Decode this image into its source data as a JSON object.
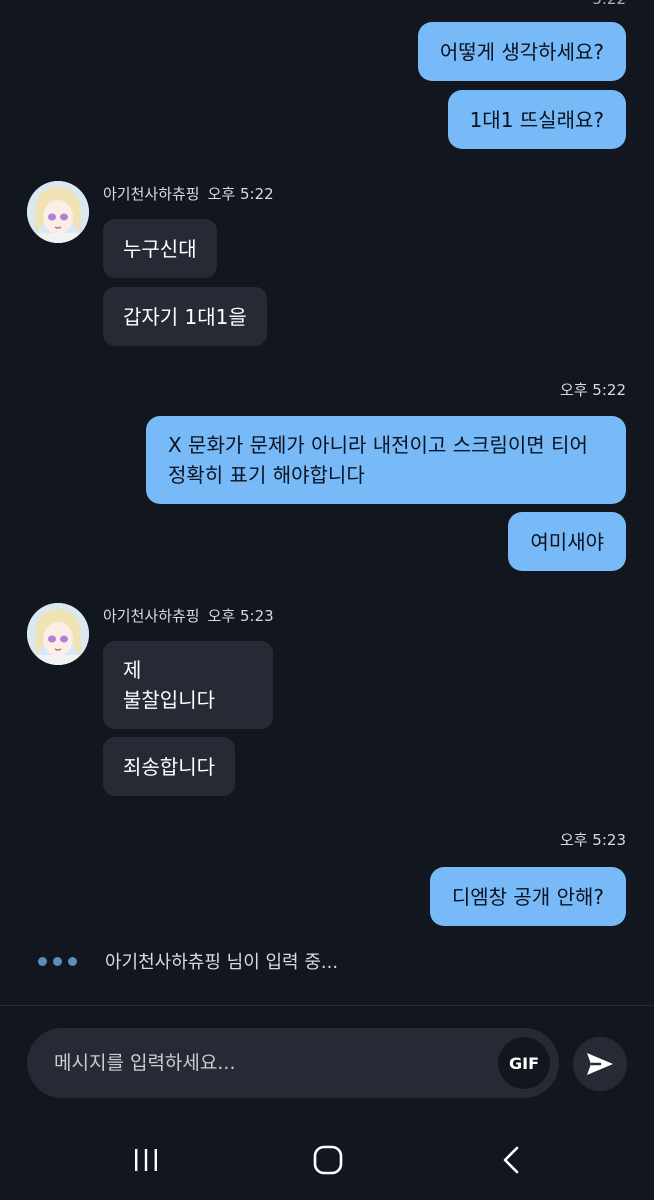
{
  "chat": {
    "top_timestamp_partial": "5:22",
    "messages": [
      {
        "type": "out",
        "text": "어떻게 생각하세요?"
      },
      {
        "type": "out",
        "text": "1대1 뜨실래요?"
      },
      {
        "type": "in_header",
        "sender": "아기천사하츄핑",
        "time": "오후 5:22"
      },
      {
        "type": "in",
        "text": "누구신대"
      },
      {
        "type": "in",
        "text": "갑자기 1대1을"
      },
      {
        "type": "out_time",
        "time": "오후 5:22"
      },
      {
        "type": "out",
        "text": "X 문화가 문제가 아니라 내전이고 스크림이면 티어 정확히 표기 해야합니다"
      },
      {
        "type": "out",
        "text": "여미새야"
      },
      {
        "type": "in_header",
        "sender": "아기천사하츄핑",
        "time": "오후 5:23"
      },
      {
        "type": "in",
        "text": "제\n불찰입니다"
      },
      {
        "type": "in",
        "text": "죄송합니다"
      },
      {
        "type": "out_time",
        "time": "오후 5:23"
      },
      {
        "type": "out",
        "text": "디엠창 공개 안해?"
      }
    ],
    "typing_indicator": "아기천사하츄핑 님이 입력 중..."
  },
  "composer": {
    "placeholder": "메시지를 입력하세요...",
    "gif_label": "GIF",
    "send_icon": "send-icon"
  },
  "navbar": {
    "recent_icon": "recent-apps-icon",
    "home_icon": "home-icon",
    "back_icon": "back-icon"
  },
  "colors": {
    "background": "#12161f",
    "outgoing_bubble": "#78b9f8",
    "incoming_bubble": "#252a35",
    "typing_dots": "#5b8fb8"
  }
}
